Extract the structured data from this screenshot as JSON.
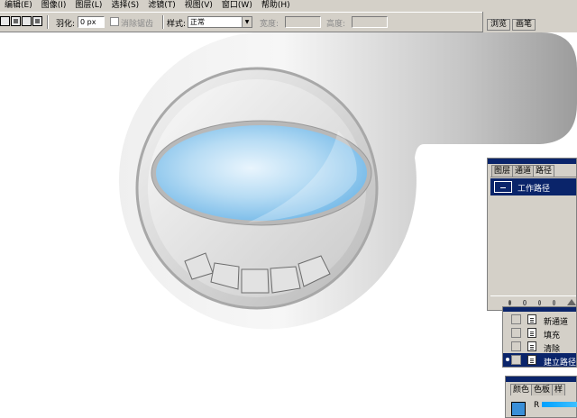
{
  "menu": {
    "items": [
      "编辑(E)",
      "图像(I)",
      "图层(L)",
      "选择(S)",
      "滤镜(T)",
      "视图(V)",
      "窗口(W)",
      "帮助(H)"
    ]
  },
  "options": {
    "feather_label": "羽化:",
    "feather_value": "0 px",
    "antialias_label": "消除锯齿",
    "style_label": "样式:",
    "style_value": "正常",
    "width_label": "宽度:",
    "height_label": "高度:"
  },
  "palette_well": {
    "tabs": [
      "浏览",
      "画笔"
    ]
  },
  "paths_panel": {
    "tabs": [
      "图层",
      "通道",
      "路径"
    ],
    "active_tab": "路径",
    "work_path_label": "工作路径"
  },
  "actions_panel": {
    "items": [
      "新通道",
      "填充",
      "清除",
      "建立路径"
    ],
    "selected": "建立路径"
  },
  "color_panel": {
    "tabs": [
      "颜色",
      "色板",
      "样"
    ],
    "r_label": "R",
    "color": "#3a8fd8"
  },
  "colors": {
    "chrome": "#d4d0c8",
    "selection": "#0a246a",
    "ellipse_light": "#e8f4fc",
    "ellipse_blue": "#7cc0ea"
  }
}
